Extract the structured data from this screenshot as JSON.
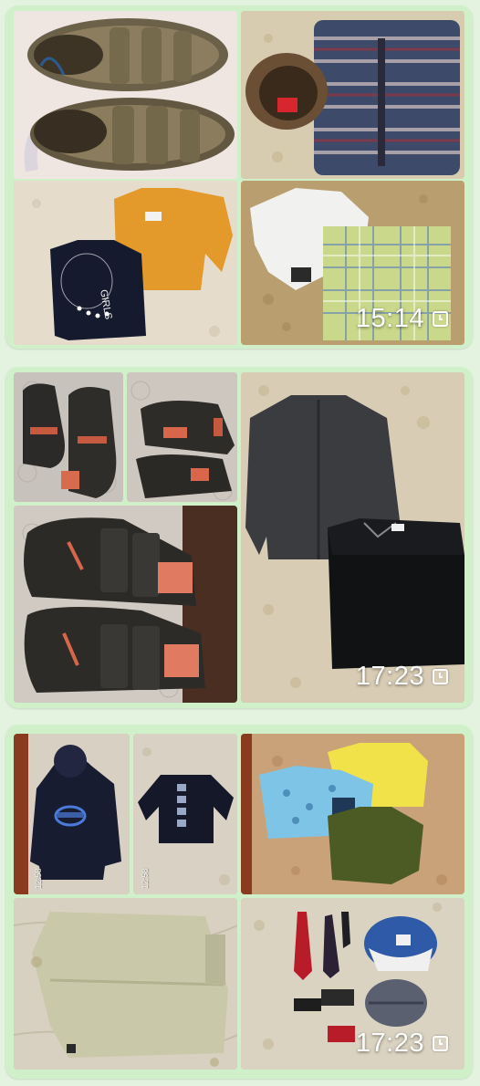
{
  "messages": [
    {
      "time": "15:14",
      "photos": [
        {
          "icon": "sandals-photo-icon",
          "alt": "sandals"
        },
        {
          "icon": "winter-jacket-photo-icon",
          "alt": "jacket"
        },
        {
          "icon": "tshirts-photo-icon",
          "alt": "tshirts"
        },
        {
          "icon": "shirts-photo-icon",
          "alt": "shirts"
        }
      ],
      "print_text": "GIRLS"
    },
    {
      "time": "17:23",
      "photos": [
        {
          "icon": "boots-photo-icon",
          "alt": "boots"
        },
        {
          "icon": "boots-side-photo-icon",
          "alt": "boots side"
        },
        {
          "icon": "boots-closeup-photo-icon",
          "alt": "boots closeup"
        },
        {
          "icon": "fleece-jackets-photo-icon",
          "alt": "fleece and sweater"
        }
      ]
    },
    {
      "time": "17:23",
      "photos": [
        {
          "icon": "hoodie-photo-icon",
          "alt": "hoodie"
        },
        {
          "icon": "longsleeve-photo-icon",
          "alt": "long sleeve"
        },
        {
          "icon": "tshirts-stack-photo-icon",
          "alt": "tshirts"
        },
        {
          "icon": "pants-photo-icon",
          "alt": "pants"
        },
        {
          "icon": "ties-cap-photo-icon",
          "alt": "ties and cap"
        }
      ],
      "photo_stamps": [
        "12:58",
        "12:58"
      ]
    }
  ],
  "colors": {
    "chat_bg": "#e4f3e0",
    "bubble_bg": "#cff0c8",
    "timestamp": "#ffffff"
  }
}
